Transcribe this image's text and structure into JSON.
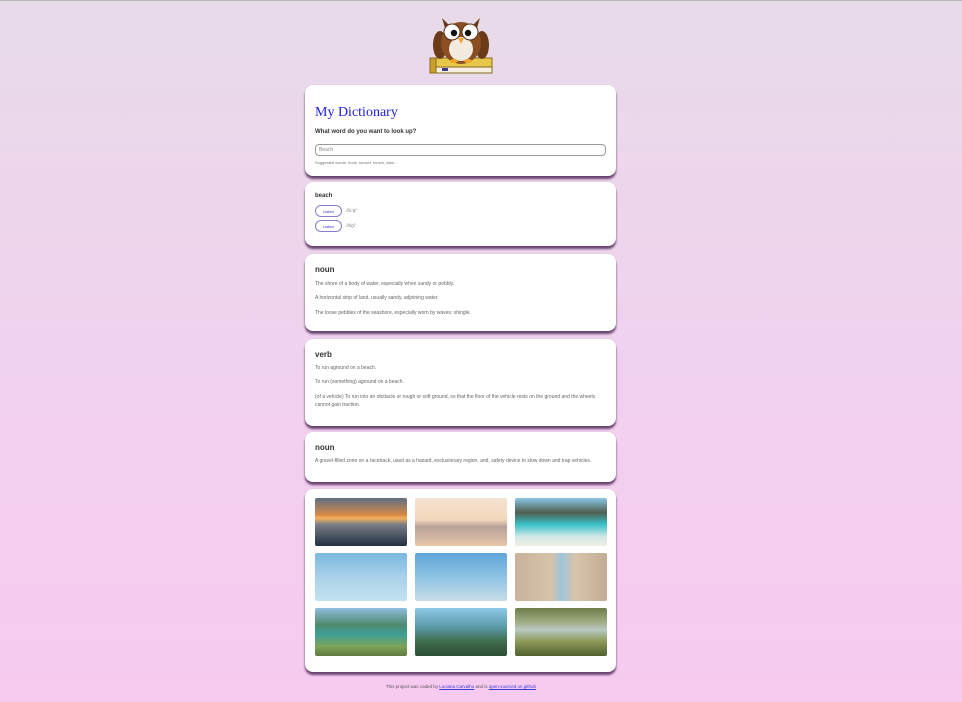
{
  "header": {
    "logo_icon": "owl-on-book-icon"
  },
  "search": {
    "title": "My Dictionary",
    "question": "What word do you want to look up?",
    "value": "",
    "placeholder": "Beach",
    "hint": "Suggested words: book, sunset, beach, wine..."
  },
  "word": {
    "text": "beach",
    "phonetics": [
      {
        "button_label": "Listen",
        "text": "/biːtʃ/"
      },
      {
        "button_label": "Listen",
        "text": "/bitʃ/"
      }
    ]
  },
  "meanings": [
    {
      "part_of_speech": "noun",
      "definitions": [
        "The shore of a body of water, especially when sandy or pebbly.",
        "A horizontal strip of land, usually sandy, adjoining water.",
        "The loose pebbles of the seashore, especially worn by waves; shingle."
      ]
    },
    {
      "part_of_speech": "verb",
      "definitions": [
        "To run aground on a beach.",
        "To run (something) aground on a beach.",
        "(of a vehicle) To run into an obstacle or rough or soft ground, so that the floor of the vehicle rests on the ground and the wheels cannot gain traction."
      ]
    },
    {
      "part_of_speech": "noun",
      "definitions": [
        "A gravel-filled zone on a racetrack, used as a hazard, exclusionary region, and, safety device to slow down and trap vehicles."
      ]
    }
  ],
  "photos": {
    "count": 9
  },
  "footer": {
    "prefix": "This project was coded by ",
    "author_link": "Luciana Carvalho",
    "middle": " and is ",
    "repo_link": "open-sourced on github"
  }
}
